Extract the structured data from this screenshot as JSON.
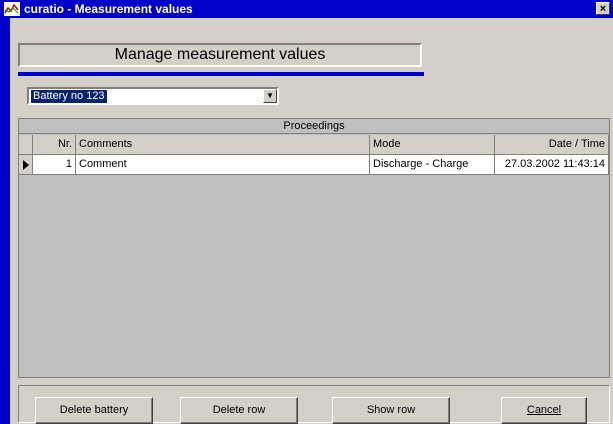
{
  "window": {
    "title": "curatio - Measurement values",
    "close_glyph": "×"
  },
  "header": {
    "title": "Manage measurement values",
    "accent_color": "#0000c8"
  },
  "battery_select": {
    "selected": "Battery no 123"
  },
  "proceedings": {
    "caption": "Proceedings",
    "columns": [
      "Nr.",
      "Comments",
      "Mode",
      "Date / Time"
    ],
    "rows": [
      {
        "nr": "1",
        "comment": "Comment",
        "mode": "Discharge - Charge",
        "datetime": "27.03.2002 11:43:14",
        "selected": true
      }
    ]
  },
  "buttons": {
    "delete_battery": "Delete battery",
    "delete_row": "Delete row",
    "show_row": "Show row",
    "cancel": "Cancel"
  },
  "icons": {
    "app": "chart-icon",
    "close": "close-icon",
    "dropdown": "chevron-down-icon",
    "row_pointer": "triangle-right-icon"
  }
}
